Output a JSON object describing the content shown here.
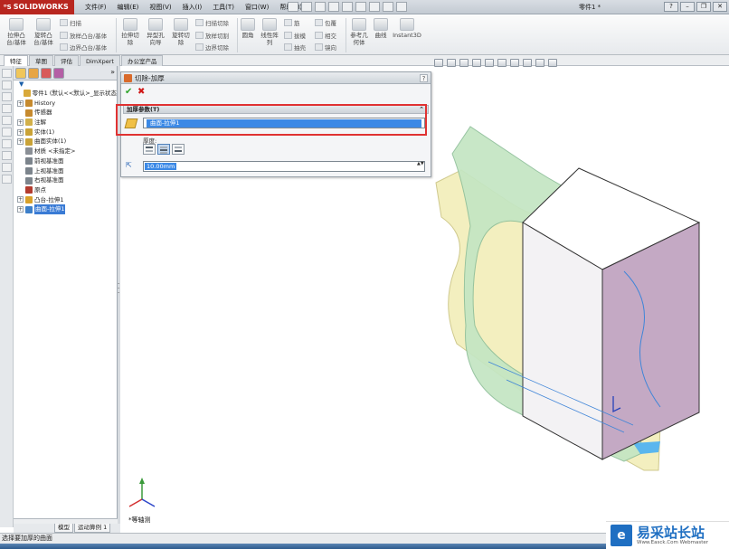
{
  "app": {
    "brand": "SOLIDWORKS",
    "document_title": "零件1 *"
  },
  "menu": [
    "文件(F)",
    "编辑(E)",
    "视图(V)",
    "插入(I)",
    "工具(T)",
    "窗口(W)",
    "帮助(H)"
  ],
  "ribbon": {
    "big_buttons": [
      {
        "line1": "拉伸凸",
        "line2": "台/基体"
      },
      {
        "line1": "旋转凸",
        "line2": "台/基体"
      },
      {
        "line1": "拉伸切",
        "line2": "除"
      },
      {
        "line1": "异型孔",
        "line2": "向导"
      },
      {
        "line1": "旋转切",
        "line2": "除"
      },
      {
        "line1": "圆角",
        "line2": ""
      },
      {
        "line1": "线性阵",
        "line2": "列"
      },
      {
        "line1": "参考几",
        "line2": "何体"
      },
      {
        "line1": "曲线",
        "line2": ""
      },
      {
        "line1": "Instant3D",
        "line2": ""
      }
    ],
    "small_group1": [
      "扫描",
      "放样凸台/基体",
      "边界凸台/基体"
    ],
    "small_group2": [
      "扫描切除",
      "放样切割",
      "边界切除"
    ],
    "small_group3": [
      "筋",
      "拔模",
      "抽壳"
    ],
    "small_group4": [
      "包覆",
      "相交",
      "镜向"
    ]
  },
  "command_tabs": [
    "特征",
    "草图",
    "评估",
    "DimXpert",
    "办公室产品"
  ],
  "feature_tree": {
    "filter_icon": "filter-icon",
    "items": [
      {
        "label": "零件1  (默认<<默认>_显示状态",
        "exp": "",
        "icon_color": "#d9a93a"
      },
      {
        "label": "History",
        "exp": "+",
        "icon_color": "#c68a2e"
      },
      {
        "label": "传感器",
        "exp": "",
        "icon_color": "#c68a2e"
      },
      {
        "label": "注解",
        "exp": "+",
        "icon_color": "#d2b04a"
      },
      {
        "label": "实体(1)",
        "exp": "+",
        "icon_color": "#c9a237"
      },
      {
        "label": "曲面实体(1)",
        "exp": "+",
        "icon_color": "#c9a237"
      },
      {
        "label": "材质 <未指定>",
        "exp": "",
        "icon_color": "#8a8f96"
      },
      {
        "label": "前视基准面",
        "exp": "",
        "icon_color": "#7c848c"
      },
      {
        "label": "上视基准面",
        "exp": "",
        "icon_color": "#7c848c"
      },
      {
        "label": "右视基准面",
        "exp": "",
        "icon_color": "#7c848c"
      },
      {
        "label": "原点",
        "exp": "",
        "icon_color": "#b33b2e"
      },
      {
        "label": "凸台-拉伸1",
        "exp": "+",
        "icon_color": "#d8a12b"
      },
      {
        "label": "曲面-拉伸1",
        "exp": "+",
        "icon_color": "#3d7fc9"
      }
    ]
  },
  "property_manager": {
    "title": "切除-加厚",
    "help": "?",
    "ok": "✔",
    "cancel": "✖",
    "group_title": "加厚参数(T)",
    "collapse": "⌃",
    "selected_face": "曲面-拉伸1",
    "side_label": "厚度:",
    "thickness_value": "10.00mm",
    "thickness_icon": "⇱",
    "spin": "▲▼"
  },
  "viewport": {
    "view_name": "*等轴测",
    "colors": {
      "surface_green": "#c4e6c3",
      "surface_yellow": "#f3efbf",
      "box_front": "#f3f2f4",
      "box_side": "#c4a9c4",
      "box_top": "#ffffff",
      "highlight_blue": "#5ab6ee"
    }
  },
  "bottom_tabs": [
    "模型",
    "运动算例 1"
  ],
  "status_text": "选择要加厚的曲面",
  "watermark": {
    "mark": "e",
    "title": "易采站长站",
    "subtitle": "Www.Easck.Com  Webmaster"
  }
}
